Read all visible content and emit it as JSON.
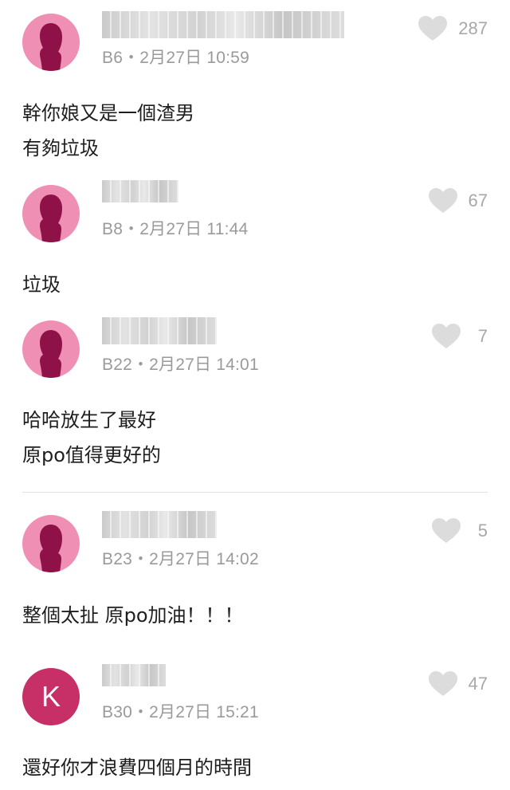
{
  "comments": [
    {
      "floor": "B6",
      "date": "2月27日",
      "time": "10:59",
      "likes": "287",
      "lines": [
        "幹你娘又是一個渣男",
        "有夠垃圾"
      ],
      "avatar": "female-icon"
    },
    {
      "floor": "B8",
      "date": "2月27日",
      "time": "11:44",
      "likes": "67",
      "lines": [
        "垃圾"
      ],
      "avatar": "female-icon"
    },
    {
      "floor": "B22",
      "date": "2月27日",
      "time": "14:01",
      "likes": "7",
      "lines": [
        "哈哈放生了最好",
        "原po值得更好的"
      ],
      "avatar": "female-icon"
    },
    {
      "floor": "B23",
      "date": "2月27日",
      "time": "14:02",
      "likes": "5",
      "lines": [
        "整個太扯 原po加油！！！"
      ],
      "avatar": "female-icon"
    },
    {
      "floor": "B30",
      "date": "2月27日",
      "time": "15:21",
      "likes": "47",
      "lines": [
        "還好你才浪費四個月的時間"
      ],
      "avatar": "letter",
      "avatar_letter": "K"
    }
  ],
  "meta_separator": "・",
  "colors": {
    "female_avatar_bg": "#f08fb4",
    "female_silhouette": "#8e1248",
    "letter_avatar_bg": "#c73067",
    "heart": "#dcdcdc",
    "meta_text": "#9a9a9a"
  }
}
